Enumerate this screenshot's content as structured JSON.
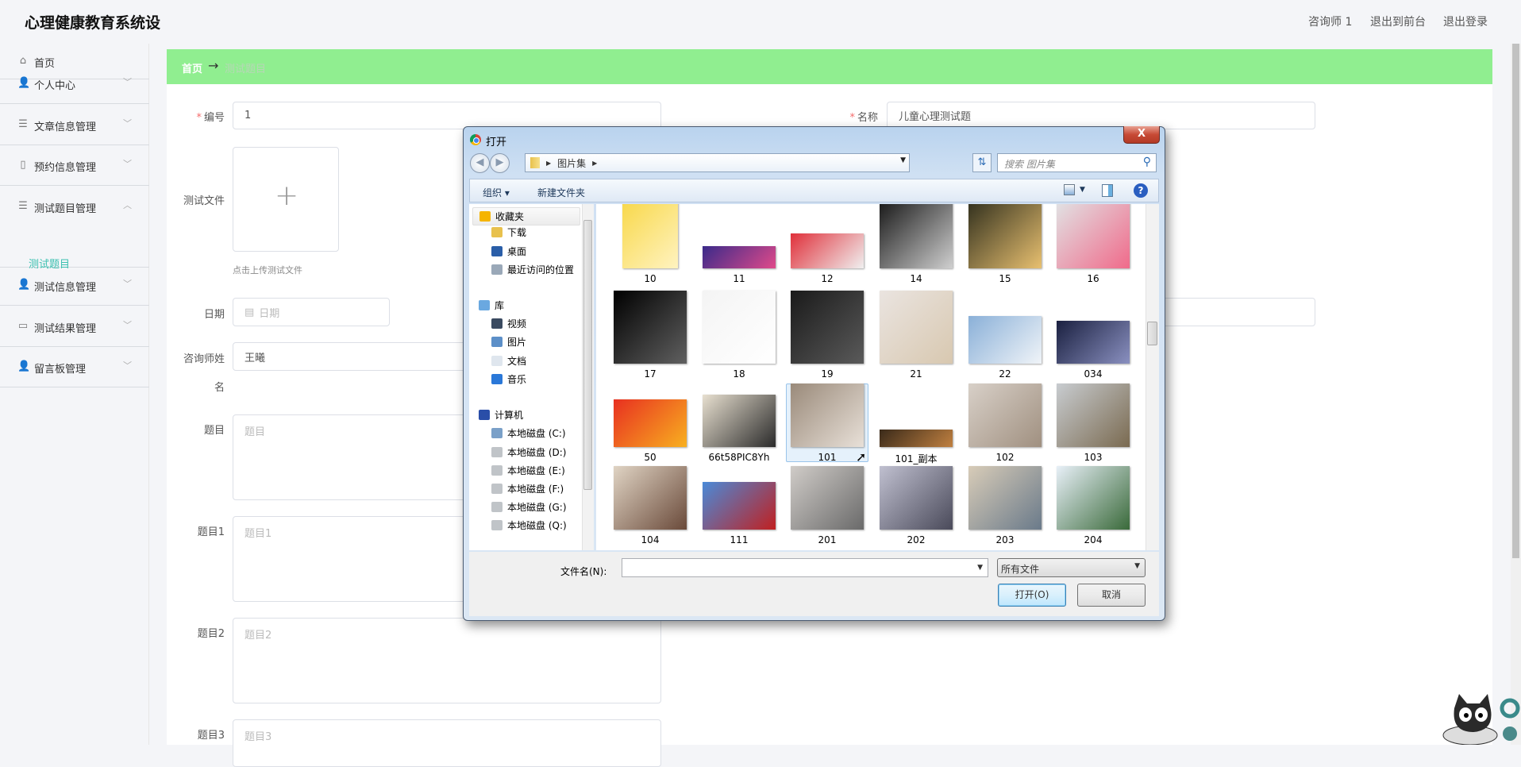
{
  "header": {
    "title": "心理健康教育系统设",
    "user": "咨询师 1",
    "to_front": "退出到前台",
    "logout": "退出登录"
  },
  "sidebar": {
    "items": [
      {
        "label": "首页",
        "icon": "home-icon",
        "glyph": "⌂",
        "chev": ""
      },
      {
        "label": "个人中心",
        "icon": "user-icon",
        "glyph": "👤",
        "chev": "﹀"
      },
      {
        "label": "文章信息管理",
        "icon": "menu-icon",
        "glyph": "☰",
        "chev": "﹀"
      },
      {
        "label": "预约信息管理",
        "icon": "microphone-icon",
        "glyph": "▯",
        "chev": "﹀"
      },
      {
        "label": "测试题目管理",
        "icon": "menu-icon",
        "glyph": "☰",
        "chev": "︿"
      },
      {
        "label": "测试信息管理",
        "icon": "user-icon",
        "glyph": "👤",
        "chev": "﹀"
      },
      {
        "label": "测试结果管理",
        "icon": "message-icon",
        "glyph": "▭",
        "chev": "﹀"
      },
      {
        "label": "留言板管理",
        "icon": "user-icon",
        "glyph": "👤",
        "chev": "﹀"
      }
    ],
    "sub_item": "测试题目"
  },
  "breadcrumb": {
    "home": "首页",
    "arrow": "→",
    "current": "测试题目"
  },
  "form": {
    "code_label": "编号",
    "code_value": "1",
    "name_label": "名称",
    "name_value": "儿童心理测试题",
    "file_label": "测试文件",
    "upload_plus": "+",
    "upload_hint": "点击上传测试文件",
    "date_label": "日期",
    "date_placeholder": "日期",
    "counselor_label_1": "咨询师姓",
    "counselor_label_2": "名",
    "counselor_value": "王曦",
    "q_label": "题目",
    "q_placeholder": "题目",
    "q1_label": "题目1",
    "q1_placeholder": "题目1",
    "q2_label": "题目2",
    "q2_placeholder": "题目2",
    "q3_label": "题目3",
    "q3_placeholder": "题目3"
  },
  "dialog": {
    "title": "打开",
    "close": "X",
    "back": "◀",
    "forward": "▶",
    "path": "图片集",
    "search_placeholder": "搜索 图片集",
    "organize": "组织 ▾",
    "new_folder": "新建文件夹",
    "nav": [
      {
        "label": "收藏夹",
        "color": "#f5b400",
        "indent": 0
      },
      {
        "label": "下载",
        "color": "#e8c14d",
        "indent": 1
      },
      {
        "label": "桌面",
        "color": "#2a5ea8",
        "indent": 1
      },
      {
        "label": "最近访问的位置",
        "color": "#9aa8b8",
        "indent": 1
      },
      {
        "label": "库",
        "color": "#6aa8e0",
        "indent": 0
      },
      {
        "label": "视频",
        "color": "#3a4a60",
        "indent": 1
      },
      {
        "label": "图片",
        "color": "#5c8fc8",
        "indent": 1
      },
      {
        "label": "文档",
        "color": "#dfe6ee",
        "indent": 1
      },
      {
        "label": "音乐",
        "color": "#2a78d8",
        "indent": 1
      },
      {
        "label": "计算机",
        "color": "#2a4ea8",
        "indent": 0
      },
      {
        "label": "本地磁盘 (C:)",
        "color": "#7aa0c8",
        "indent": 1
      },
      {
        "label": "本地磁盘 (D:)",
        "color": "#c0c4c8",
        "indent": 1
      },
      {
        "label": "本地磁盘 (E:)",
        "color": "#c0c4c8",
        "indent": 1
      },
      {
        "label": "本地磁盘 (F:)",
        "color": "#c0c4c8",
        "indent": 1
      },
      {
        "label": "本地磁盘 (G:)",
        "color": "#c0c4c8",
        "indent": 1
      },
      {
        "label": "本地磁盘 (Q:)",
        "color": "#c0c4c8",
        "indent": 1
      }
    ],
    "files": [
      {
        "name": "10",
        "colors": [
          "#f8d84a",
          "#fff3c0"
        ]
      },
      {
        "name": "11",
        "colors": [
          "#3a2a8a",
          "#e04a8a"
        ]
      },
      {
        "name": "12",
        "colors": [
          "#e0303a",
          "#f0f0f0"
        ]
      },
      {
        "name": "14",
        "colors": [
          "#111111",
          "#cfcfcf"
        ]
      },
      {
        "name": "15",
        "colors": [
          "#2a2a1a",
          "#e8c070"
        ]
      },
      {
        "name": "16",
        "colors": [
          "#e0e8e8",
          "#f06a8a"
        ]
      },
      {
        "name": "17",
        "colors": [
          "#000000",
          "#606060"
        ]
      },
      {
        "name": "18",
        "colors": [
          "#f4f4f4",
          "#ffffff"
        ]
      },
      {
        "name": "19",
        "colors": [
          "#1a1a1a",
          "#5a5a5a"
        ]
      },
      {
        "name": "21",
        "colors": [
          "#eae4e0",
          "#d8c8b0"
        ]
      },
      {
        "name": "22",
        "colors": [
          "#8ab0d8",
          "#f0f4f8"
        ]
      },
      {
        "name": "034",
        "colors": [
          "#1a2040",
          "#8a90c0"
        ]
      },
      {
        "name": "50",
        "colors": [
          "#e83020",
          "#f8b020"
        ]
      },
      {
        "name": "66t58PIC8Yh",
        "colors": [
          "#e8e0d0",
          "#2a2a2a"
        ]
      },
      {
        "name": "101",
        "colors": [
          "#9a8a7a",
          "#e8e0d8"
        ]
      },
      {
        "name": "101_副本",
        "colors": [
          "#3a2a1a",
          "#c08040"
        ]
      },
      {
        "name": "102",
        "colors": [
          "#d8d0c8",
          "#a09080"
        ]
      },
      {
        "name": "103",
        "colors": [
          "#c8ccd0",
          "#7a6a50"
        ]
      },
      {
        "name": "104",
        "colors": [
          "#e0d4c4",
          "#6a4a3a"
        ]
      },
      {
        "name": "111",
        "colors": [
          "#4a8ad8",
          "#c02020"
        ]
      },
      {
        "name": "201",
        "colors": [
          "#d0ccc8",
          "#6a6a6a"
        ]
      },
      {
        "name": "202",
        "colors": [
          "#c0c0d0",
          "#4a4a5a"
        ]
      },
      {
        "name": "203",
        "colors": [
          "#d8ccb8",
          "#6a7a8a"
        ]
      },
      {
        "name": "204",
        "colors": [
          "#e8f0f8",
          "#3a6a3a"
        ]
      }
    ],
    "selected_file": "101",
    "filename_label": "文件名(N):",
    "filename_value": "",
    "filetype": "所有文件",
    "open": "打开(O)",
    "cancel": "取消"
  }
}
